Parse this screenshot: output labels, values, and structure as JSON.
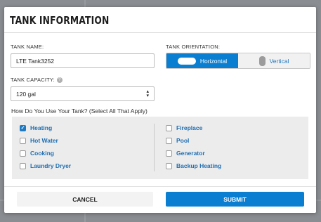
{
  "modal": {
    "title": "TANK INFORMATION"
  },
  "tank_name": {
    "label": "TANK NAME:",
    "value": "LTE Tank3252"
  },
  "orientation": {
    "label": "TANK ORIENTATION:",
    "options": [
      {
        "label": "Horizontal",
        "selected": true,
        "icon": "horizontal-tank-icon"
      },
      {
        "label": "Vertical",
        "selected": false,
        "icon": "vertical-tank-icon"
      }
    ]
  },
  "capacity": {
    "label": "TANK CAPACITY:",
    "value": "120 gal",
    "info_icon": "info-icon"
  },
  "uses": {
    "question": "How Do You Use Your Tank? (Select All That Apply)",
    "left": [
      {
        "label": "Heating",
        "checked": true
      },
      {
        "label": "Hot Water",
        "checked": false
      },
      {
        "label": "Cooking",
        "checked": false
      },
      {
        "label": "Laundry Dryer",
        "checked": false
      }
    ],
    "right": [
      {
        "label": "Fireplace",
        "checked": false
      },
      {
        "label": "Pool",
        "checked": false
      },
      {
        "label": "Generator",
        "checked": false
      },
      {
        "label": "Backup Heating",
        "checked": false
      }
    ]
  },
  "actions": {
    "cancel": "CANCEL",
    "submit": "SUBMIT"
  },
  "colors": {
    "accent": "#0a7fd1",
    "link": "#1f6fb2"
  }
}
